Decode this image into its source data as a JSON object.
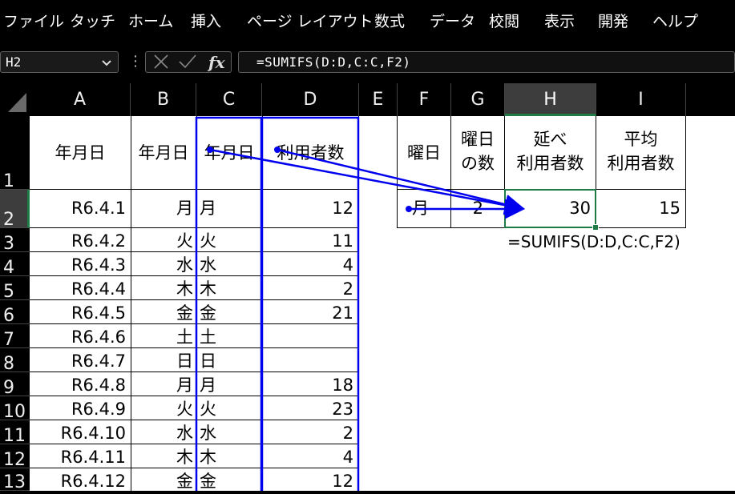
{
  "ribbon": {
    "tabs": [
      "ファイル",
      "タッチ",
      "ホーム",
      "挿入",
      "ページ レイアウト",
      "数式",
      "データ",
      "校閲",
      "表示",
      "開発",
      "ヘルプ"
    ]
  },
  "formula_bar": {
    "name_box": "H2",
    "formula": "=SUMIFS(D:D,C:C,F2)"
  },
  "columns": [
    "A",
    "B",
    "C",
    "D",
    "E",
    "F",
    "G",
    "H",
    "I"
  ],
  "rows": [
    "1",
    "2",
    "3",
    "4",
    "5",
    "6",
    "7",
    "8",
    "9",
    "10",
    "11",
    "12",
    "13"
  ],
  "headers": {
    "a": "年月日",
    "b": "年月日",
    "c": "年月日",
    "d": "利用者数",
    "f": "曜日",
    "g1": "曜日",
    "g2": "の数",
    "h1": "延べ",
    "h2": "利用者数",
    "i1": "平均",
    "i2": "利用者数"
  },
  "data_rows": [
    {
      "date": "R6.4.1",
      "b": "月",
      "c": "月",
      "d": "12"
    },
    {
      "date": "R6.4.2",
      "b": "火",
      "c": "火",
      "d": "11"
    },
    {
      "date": "R6.4.3",
      "b": "水",
      "c": "水",
      "d": "4"
    },
    {
      "date": "R6.4.4",
      "b": "木",
      "c": "木",
      "d": "2"
    },
    {
      "date": "R6.4.5",
      "b": "金",
      "c": "金",
      "d": "21"
    },
    {
      "date": "R6.4.6",
      "b": "土",
      "c": "土",
      "d": ""
    },
    {
      "date": "R6.4.7",
      "b": "日",
      "c": "日",
      "d": ""
    },
    {
      "date": "R6.4.8",
      "b": "月",
      "c": "月",
      "d": "18"
    },
    {
      "date": "R6.4.9",
      "b": "火",
      "c": "火",
      "d": "23"
    },
    {
      "date": "R6.4.10",
      "b": "水",
      "c": "水",
      "d": "2"
    },
    {
      "date": "R6.4.11",
      "b": "木",
      "c": "木",
      "d": "4"
    },
    {
      "date": "R6.4.12",
      "b": "金",
      "c": "金",
      "d": "12"
    }
  ],
  "summary": {
    "f2": "月",
    "g2": "2",
    "h2": "30",
    "i2": "15"
  },
  "note": "=SUMIFS(D:D,C:C,F2)",
  "colors": {
    "highlight": "#0000ee",
    "selection": "#1e7b45"
  }
}
